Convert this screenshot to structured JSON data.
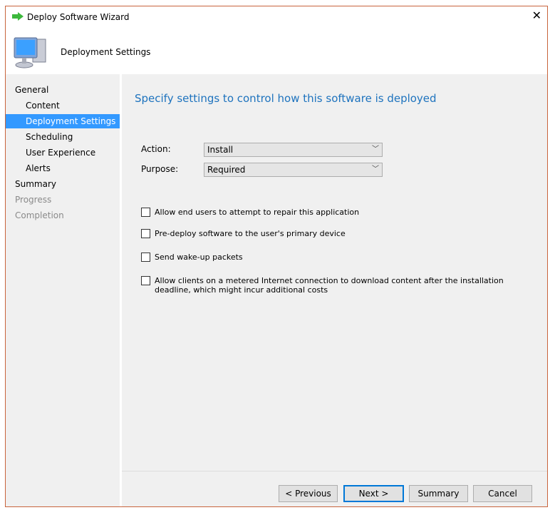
{
  "window": {
    "title": "Deploy Software Wizard",
    "header": "Deployment Settings"
  },
  "nav": [
    {
      "label": "General",
      "state": "normal",
      "indent": 0
    },
    {
      "label": "Content",
      "state": "normal",
      "indent": 1
    },
    {
      "label": "Deployment Settings",
      "state": "selected",
      "indent": 1
    },
    {
      "label": "Scheduling",
      "state": "normal",
      "indent": 1
    },
    {
      "label": "User Experience",
      "state": "normal",
      "indent": 1
    },
    {
      "label": "Alerts",
      "state": "normal",
      "indent": 1
    },
    {
      "label": "Summary",
      "state": "normal",
      "indent": 0
    },
    {
      "label": "Progress",
      "state": "disabled",
      "indent": 0
    },
    {
      "label": "Completion",
      "state": "disabled",
      "indent": 0
    }
  ],
  "main": {
    "heading": "Specify settings to control how this software is deployed",
    "action_label": "Action:",
    "action_value": "Install",
    "purpose_label": "Purpose:",
    "purpose_value": "Required",
    "checkboxes": [
      {
        "label": "Allow end users to attempt to repair this application",
        "checked": false
      },
      {
        "label": "Pre-deploy software to the user's primary device",
        "checked": false
      },
      {
        "label": "Send wake-up packets",
        "checked": false
      },
      {
        "label": "Allow clients on a metered Internet connection to download content after the installation deadline, which might incur additional costs",
        "checked": false
      }
    ]
  },
  "buttons": {
    "previous": "< Previous",
    "next": "Next >",
    "summary": "Summary",
    "cancel": "Cancel"
  },
  "colors": {
    "accent": "#3399ff",
    "heading": "#1e73be",
    "border": "#c8643c"
  }
}
